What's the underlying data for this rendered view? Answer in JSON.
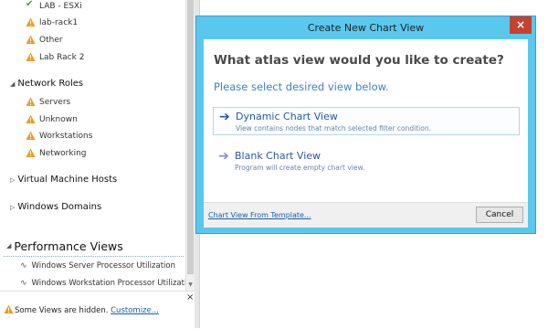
{
  "nav": {
    "items_top": [
      {
        "label": "LAB - ESXi",
        "icon": "check-icon"
      },
      {
        "label": "lab-rack1",
        "icon": "warning-icon"
      },
      {
        "label": "Other",
        "icon": "warning-icon"
      },
      {
        "label": "Lab Rack 2",
        "icon": "warning-icon"
      }
    ],
    "network_roles": {
      "label": "Network Roles",
      "items": [
        {
          "label": "Servers",
          "icon": "warning-icon"
        },
        {
          "label": "Unknown",
          "icon": "warning-icon"
        },
        {
          "label": "Workstations",
          "icon": "warning-icon"
        },
        {
          "label": "Networking",
          "icon": "warning-icon"
        }
      ]
    },
    "vm_hosts_label": "Virtual Machine Hosts",
    "windows_domains_label": "Windows Domains",
    "performance_views": {
      "label": "Performance Views",
      "items": [
        "Windows Server Processor Utilization",
        "Windows Workstation Processor Utilization"
      ]
    }
  },
  "notice": {
    "text": "Some Views are hidden.",
    "link": "Customize...",
    "close": "×"
  },
  "dialog": {
    "title": "Create New Chart View",
    "close": "×",
    "heading": "What atlas view would you like to create?",
    "subheading": "Please select desired view below.",
    "options": [
      {
        "title": "Dynamic Chart View",
        "description": "View contains nodes that match selected filter condition.",
        "selected": true
      },
      {
        "title": "Blank Chart View",
        "description": "Program will create empty chart view.",
        "selected": false
      }
    ],
    "template_link": "Chart View From Template...",
    "cancel_label": "Cancel"
  },
  "colors": {
    "dialog_frame": "#5ac8ee",
    "close_button": "#c7412f",
    "link": "#1a5ea8",
    "option_text": "#2b56a8",
    "warning": "#f29a1c",
    "check": "#4a9a2a"
  }
}
